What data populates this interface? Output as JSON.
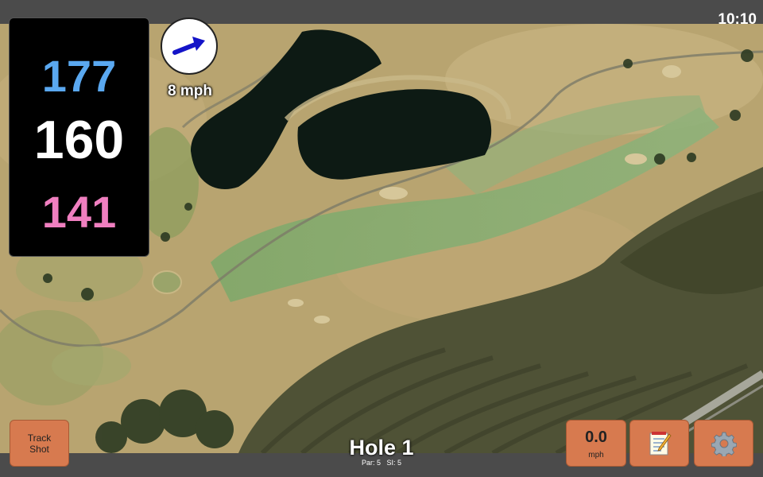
{
  "status_bar": {
    "time": "10:10"
  },
  "yardage": {
    "back": "177",
    "center": "160",
    "front": "141",
    "colors": {
      "back": "#5aa8f0",
      "center": "#ffffff",
      "front": "#f07fc0"
    }
  },
  "wind": {
    "speed": "8 mph",
    "arrow_color": "#1414c8",
    "icon": "wind-arrow-icon"
  },
  "hole": {
    "title": "Hole 1",
    "par_label": "Par: 5",
    "si_label": "SI: 5"
  },
  "buttons": {
    "track_shot": {
      "line1": "Track",
      "line2": "Shot"
    },
    "speed": {
      "value": "0.0",
      "unit": "mph"
    },
    "notes": {
      "icon": "notepad-icon"
    },
    "settings": {
      "icon": "gear-icon"
    }
  },
  "theme": {
    "button_bg": "#d77a4f",
    "bar_bg": "#4b4b4b",
    "wind_text": "#ffffff"
  }
}
